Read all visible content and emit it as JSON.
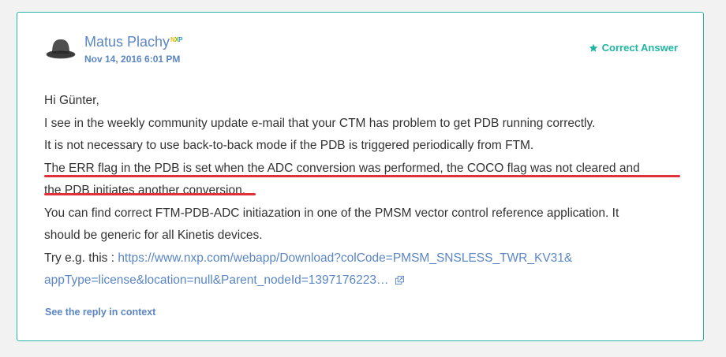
{
  "author": {
    "name": "Matus Plachy",
    "badge": [
      "N",
      "X",
      "P"
    ]
  },
  "post": {
    "date": "Nov 14, 2016 6:01 PM"
  },
  "status": {
    "label": "Correct Answer",
    "icon": "star-icon",
    "color": "#1fb6a0"
  },
  "body": {
    "line1": "Hi Günter,",
    "line2": "I see in the weekly community update e-mail that your CTM has problem to get PDB running correctly.",
    "line3": "It is not necessary to use back-to-back mode if the PDB is triggered periodically from FTM.",
    "line4": "The ERR flag in the PDB is set when the ADC conversion was performed, the COCO flag was not cleared and",
    "line5": "the PDB initiates another conversion.",
    "line6": "You can find correct FTM-PDB-ADC initiazation in one of the PMSM vector control reference application. It",
    "line7": "should be generic for all Kinetis devices.",
    "try_prefix": "Try e.g. this : ",
    "link_line1": "https://www.nxp.com/webapp/Download?colCode=PMSM_SNSLESS_TWR_KV31&",
    "link_line2": "appType=license&location=null&Parent_nodeId=1397176223…"
  },
  "footer": {
    "see_reply": "See the reply in context"
  },
  "colors": {
    "accent": "#29b6a8",
    "link": "#5b86c4",
    "highlight_underline": "#e0313a"
  }
}
